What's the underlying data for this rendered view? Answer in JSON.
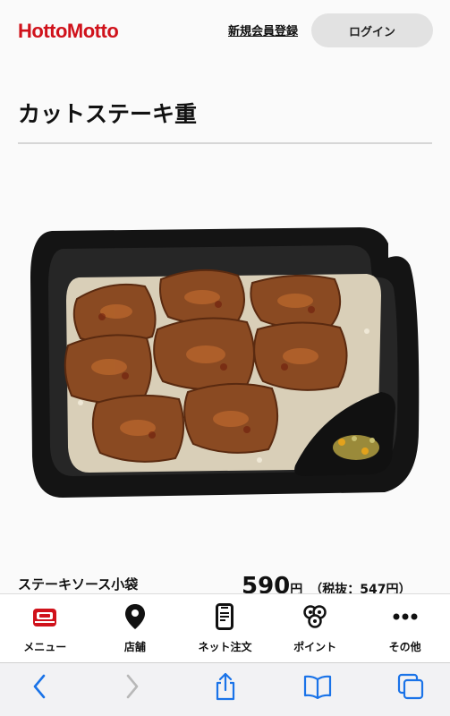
{
  "header": {
    "logo_text": "HottoMotto",
    "register_label": "新規会員登録",
    "login_label": "ログイン",
    "accent_color": "#d0121b"
  },
  "product": {
    "title": "カットステーキ重",
    "image_icon": "bento-photo"
  },
  "option": {
    "name": "ステーキソース小袋",
    "price": "590",
    "price_unit": "円",
    "price_tax": "（税抜：547円）"
  },
  "bottom_nav": {
    "items": [
      {
        "label": "メニュー",
        "icon": "bento-icon"
      },
      {
        "label": "店舗",
        "icon": "location-pin-icon"
      },
      {
        "label": "ネット注文",
        "icon": "smartphone-icon"
      },
      {
        "label": "ポイント",
        "icon": "points-icon"
      },
      {
        "label": "その他",
        "icon": "more-icon"
      }
    ]
  },
  "browser_bar": {
    "icons": [
      "back-icon",
      "forward-icon",
      "share-icon",
      "bookmarks-icon",
      "tabs-icon"
    ]
  }
}
